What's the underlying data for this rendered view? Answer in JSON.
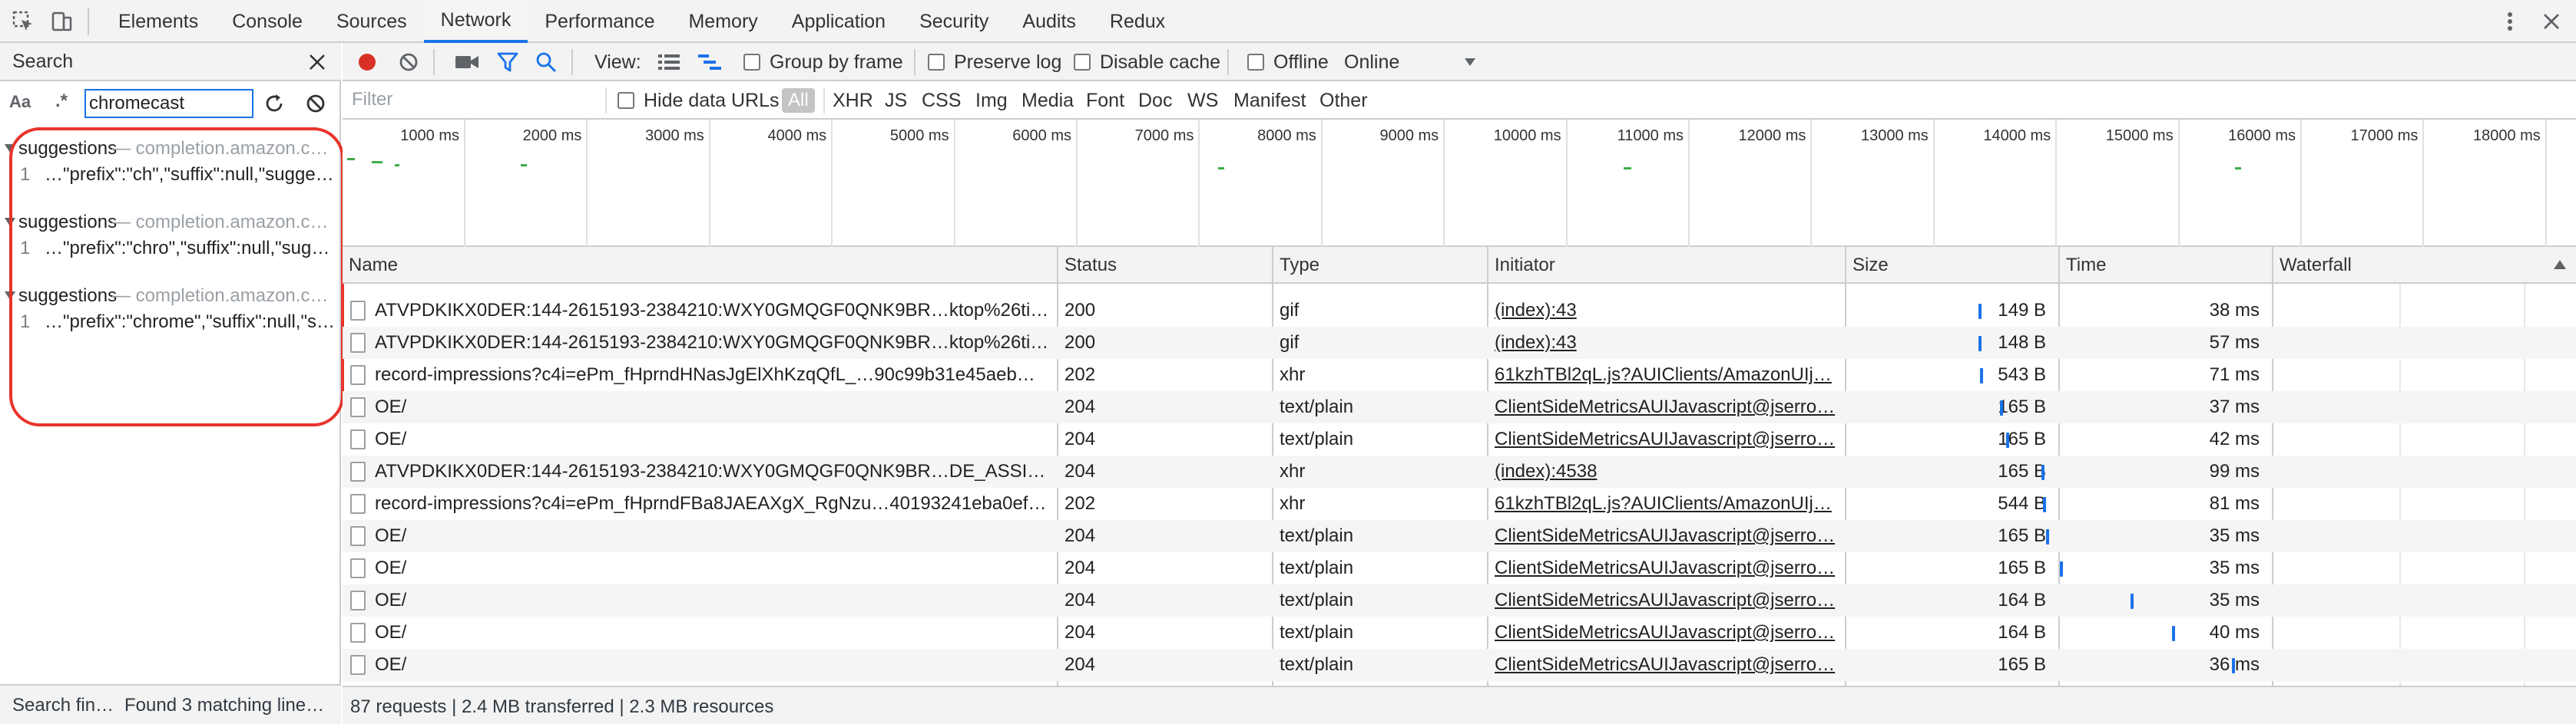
{
  "tabs": [
    {
      "label": "Elements"
    },
    {
      "label": "Console"
    },
    {
      "label": "Sources"
    },
    {
      "label": "Network"
    },
    {
      "label": "Performance"
    },
    {
      "label": "Memory"
    },
    {
      "label": "Application"
    },
    {
      "label": "Security"
    },
    {
      "label": "Audits"
    },
    {
      "label": "Redux"
    }
  ],
  "active_tab": "Network",
  "icons": {
    "inspect": "inspect-element-icon",
    "device": "device-toolbar-icon",
    "more": "more-vertical-icon",
    "close": "close-icon"
  },
  "search_pane": {
    "title": "Search",
    "case_toggle": "Aa",
    "regex_toggle": ".*",
    "query": "chromecast",
    "results": [
      {
        "name": "suggestions",
        "domain": "— completion.amazon.com",
        "line": "1",
        "text": "…\"prefix\":\"ch\",\"suffix\":null,\"suggestions\""
      },
      {
        "name": "suggestions",
        "domain": "— completion.amazon.com",
        "line": "1",
        "text": "…\"prefix\":\"chro\",\"suffix\":null,\"suggestions\""
      },
      {
        "name": "suggestions",
        "domain": "— completion.amazon.com",
        "line": "1",
        "text": "…\"prefix\":\"chrome\",\"suffix\":null,\"sugg"
      }
    ],
    "status_left": "Search fin…",
    "status_right": "Found 3 matching line…"
  },
  "toolbar": {
    "view_label": "View:",
    "group_by_frame": "Group by frame",
    "preserve_log": "Preserve log",
    "disable_cache": "Disable cache",
    "offline": "Offline",
    "throttle": "Online"
  },
  "filter": {
    "placeholder": "Filter",
    "hide_data_urls": "Hide data URLs",
    "types": [
      "All",
      "XHR",
      "JS",
      "CSS",
      "Img",
      "Media",
      "Font",
      "Doc",
      "WS",
      "Manifest",
      "Other"
    ]
  },
  "overview": {
    "ticks": [
      "1000 ms",
      "2000 ms",
      "3000 ms",
      "4000 ms",
      "5000 ms",
      "6000 ms",
      "7000 ms",
      "8000 ms",
      "9000 ms",
      "10000 ms",
      "11000 ms",
      "12000 ms",
      "13000 ms",
      "14000 ms",
      "15000 ms",
      "16000 ms",
      "17000 ms",
      "18000 ms"
    ]
  },
  "columns": {
    "name": "Name",
    "status": "Status",
    "type": "Type",
    "initiator": "Initiator",
    "size": "Size",
    "time": "Time",
    "waterfall": "Waterfall"
  },
  "rows": [
    {
      "name": "ATVPDKIKX0DER:144-2615193-2384210:WXY0GMQGF0QNK9BR…ktop%26ti…",
      "status": "200",
      "type": "gif",
      "initiator": "(index):43",
      "size": "149 B",
      "time": "38 ms"
    },
    {
      "name": "ATVPDKIKX0DER:144-2615193-2384210:WXY0GMQGF0QNK9BR…ktop%26ti…",
      "status": "200",
      "type": "gif",
      "initiator": "(index):43",
      "size": "148 B",
      "time": "57 ms"
    },
    {
      "name": "record-impressions?c4i=ePm_fHprndHNasJgElXhKzqQfL_…90c99b31e45aeb…",
      "status": "202",
      "type": "xhr",
      "initiator": "61kzhTBl2qL.js?AUIClients/AmazonUIj…",
      "size": "543 B",
      "time": "71 ms"
    },
    {
      "name": "OE/",
      "status": "204",
      "type": "text/plain",
      "initiator": "ClientSideMetricsAUIJavascript@jserro…",
      "size": "165 B",
      "time": "37 ms"
    },
    {
      "name": "OE/",
      "status": "204",
      "type": "text/plain",
      "initiator": "ClientSideMetricsAUIJavascript@jserro…",
      "size": "165 B",
      "time": "42 ms"
    },
    {
      "name": "ATVPDKIKX0DER:144-2615193-2384210:WXY0GMQGF0QNK9BR…DE_ASSI…",
      "status": "204",
      "type": "xhr",
      "initiator": "(index):4538",
      "size": "165 B",
      "time": "99 ms"
    },
    {
      "name": "record-impressions?c4i=ePm_fHprndFBa8JAEAXgX_RgNzu…40193241eba0ef…",
      "status": "202",
      "type": "xhr",
      "initiator": "61kzhTBl2qL.js?AUIClients/AmazonUIj…",
      "size": "544 B",
      "time": "81 ms"
    },
    {
      "name": "OE/",
      "status": "204",
      "type": "text/plain",
      "initiator": "ClientSideMetricsAUIJavascript@jserro…",
      "size": "165 B",
      "time": "35 ms"
    },
    {
      "name": "OE/",
      "status": "204",
      "type": "text/plain",
      "initiator": "ClientSideMetricsAUIJavascript@jserro…",
      "size": "165 B",
      "time": "35 ms"
    },
    {
      "name": "OE/",
      "status": "204",
      "type": "text/plain",
      "initiator": "ClientSideMetricsAUIJavascript@jserro…",
      "size": "164 B",
      "time": "35 ms"
    },
    {
      "name": "OE/",
      "status": "204",
      "type": "text/plain",
      "initiator": "ClientSideMetricsAUIJavascript@jserro…",
      "size": "164 B",
      "time": "40 ms"
    },
    {
      "name": "OE/",
      "status": "204",
      "type": "text/plain",
      "initiator": "ClientSideMetricsAUIJavascript@jserro…",
      "size": "165 B",
      "time": "36 ms"
    }
  ],
  "status_bar": "87 requests | 2.4 MB transferred | 2.3 MB resources",
  "colors": {
    "accent": "#1a73e8",
    "record": "#d93025",
    "highlight": "#e8332b"
  }
}
